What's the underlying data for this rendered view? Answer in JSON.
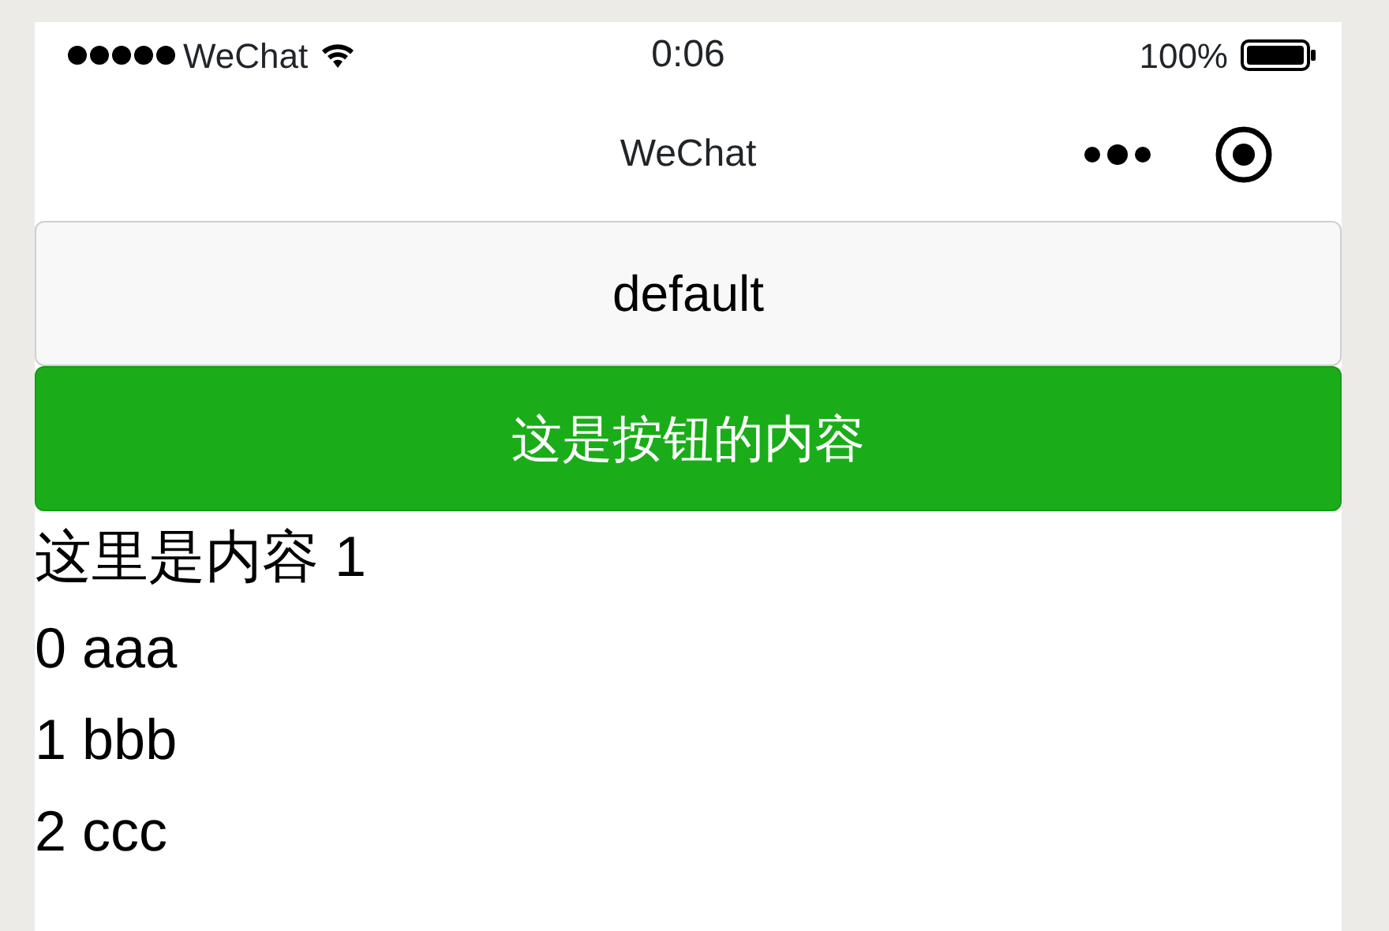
{
  "status_bar": {
    "carrier": "WeChat",
    "time": "0:06",
    "battery": "100%"
  },
  "nav_bar": {
    "title": "WeChat"
  },
  "buttons": [
    {
      "label": "default",
      "kind": "default"
    },
    {
      "label": "这是按钮的内容",
      "kind": "primary"
    }
  ],
  "lines": [
    "这里是内容 1",
    "0 aaa",
    "1 bbb",
    "2 ccc"
  ]
}
